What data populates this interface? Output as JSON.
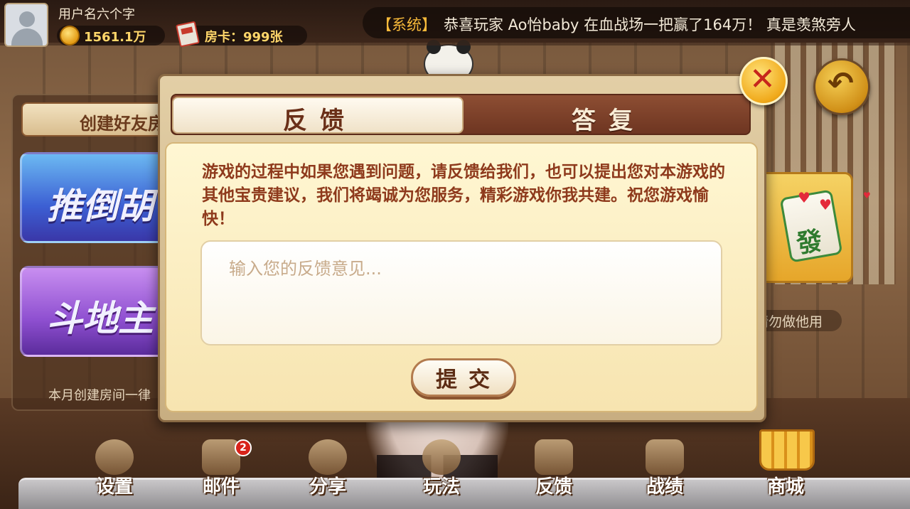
{
  "player": {
    "username": "用户名六个字",
    "gold": "1561.1万",
    "room_cards": "房卡：999张"
  },
  "marquee": {
    "tag": "【系统】",
    "message": "恭喜玩家  Ao怡baby  在血战场一把赢了164万！  真是羡煞旁人"
  },
  "left_panel": {
    "create_tab": "创建好友房",
    "modes": [
      "推倒胡",
      "斗地主"
    ],
    "note": "本月创建房间一律"
  },
  "right_panel": {
    "tile_char": "發",
    "note": "请勿做他用"
  },
  "dialog": {
    "tabs": [
      {
        "label": "反馈",
        "active": true
      },
      {
        "label": "答复",
        "active": false
      }
    ],
    "intro": "游戏的过程中如果您遇到问题，请反馈给我们，也可以提出您对本游戏的其他宝贵建议，我们将竭诚为您服务，精彩游戏你我共建。祝您游戏愉快！",
    "input_placeholder": "输入您的反馈意见...",
    "input_value": "",
    "submit_label": "提交",
    "close_icon": "close-icon",
    "back_icon": "back-arrow-icon"
  },
  "bottom_nav": {
    "items": [
      {
        "label": "设置",
        "icon": "gear-icon"
      },
      {
        "label": "邮件",
        "icon": "mail-icon",
        "badge": "2"
      },
      {
        "label": "分享",
        "icon": "chat-bubble-icon"
      },
      {
        "label": "玩法",
        "icon": "question-icon"
      },
      {
        "label": "反馈",
        "icon": "clipboard-icon"
      },
      {
        "label": "战绩",
        "icon": "trophy-icon"
      },
      {
        "label": "商城",
        "icon": "cart-icon"
      }
    ]
  },
  "colors": {
    "accent_gold": "#f6b93a",
    "tab_brown": "#6e3521",
    "content_cream": "#fff7d3",
    "intro_text": "#8e3a1c"
  }
}
